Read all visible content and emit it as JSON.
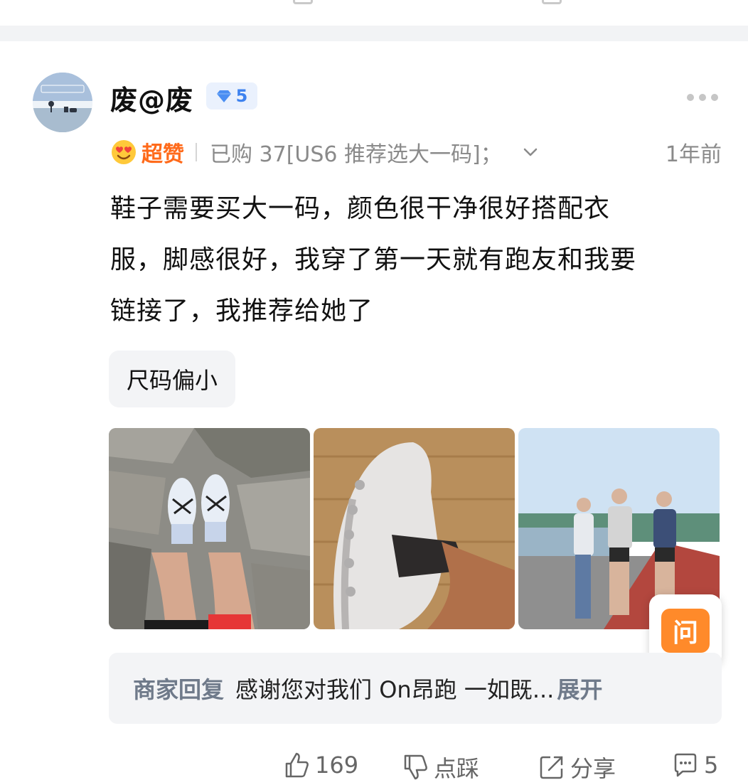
{
  "user": {
    "name": "废@废",
    "level": "5"
  },
  "meta": {
    "rating_label": "超赞",
    "purchase_info": "已购 37[US6 推荐选大一码]；",
    "time_ago": "1年前"
  },
  "review": {
    "line1": "鞋子需要买大一码，颜色很干净很好搭配衣",
    "line2": "服，脚感很好，我穿了第一天就有跑友和我要",
    "line3": "链接了，我推荐给她了"
  },
  "tag": "尺码偏小",
  "ask_button": "问",
  "merchant_reply": {
    "label": "商家回复",
    "text": "感谢您对我们 On昂跑 一如既...",
    "expand": "展开"
  },
  "actions": {
    "like_count": "169",
    "dislike_label": "点踩",
    "share_label": "分享",
    "comment_count": "5"
  },
  "icons": {
    "level": "diamond-icon",
    "rating": "heart-eyes-emoji-icon",
    "expand": "chevron-down-icon",
    "more": "more-dots-icon",
    "like": "thumbs-up-icon",
    "dislike": "thumbs-down-icon",
    "share": "share-icon",
    "comment": "comment-icon"
  },
  "colors": {
    "accent_orange": "#ff6a1a",
    "level_blue": "#3d82ef",
    "ask_orange": "#ff8a2a",
    "reply_label": "#6f7a8a"
  }
}
